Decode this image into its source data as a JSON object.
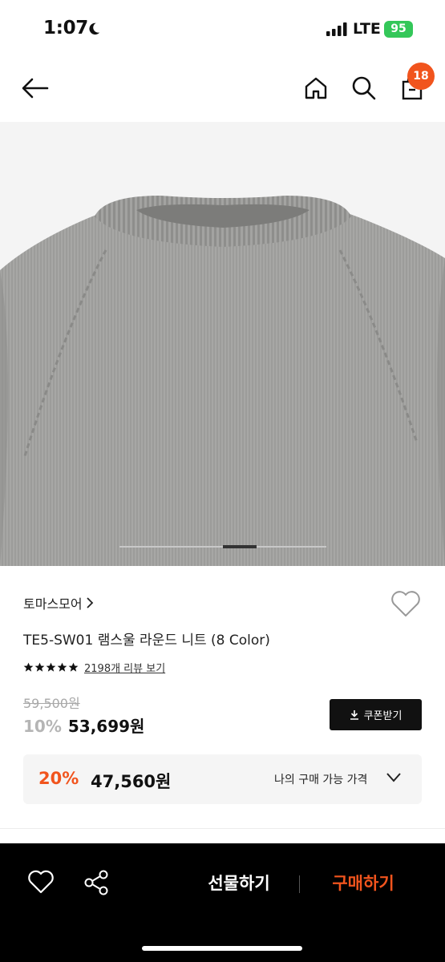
{
  "status_bar": {
    "time": "1:07",
    "network": "LTE",
    "battery": "95"
  },
  "header": {
    "cart_count": "18"
  },
  "product": {
    "brand": "토마스모어",
    "name": "TE5-SW01 램스울 라운드 니트 (8 Color)",
    "rating_stars": 5,
    "review_link": "2198개 리뷰 보기",
    "original_price": "59,500원",
    "discount_rate": "10%",
    "sale_price": "53,699원",
    "coupon_label": "쿠폰받기",
    "best_rate": "20%",
    "best_price": "47,560원",
    "best_label": "나의 구매 가능 가격"
  },
  "bottom_bar": {
    "gift_label": "선물하기",
    "buy_label": "구매하기"
  },
  "colors": {
    "accent": "#f1541d",
    "sweater": "#9a9a98",
    "dark": "#111111"
  },
  "icons": [
    "moon-icon",
    "signal-icon",
    "back-arrow-icon",
    "home-icon",
    "search-icon",
    "shopping-bag-icon",
    "chevron-right-icon",
    "heart-icon",
    "star-icon",
    "download-icon",
    "chevron-down-icon",
    "share-icon"
  ]
}
